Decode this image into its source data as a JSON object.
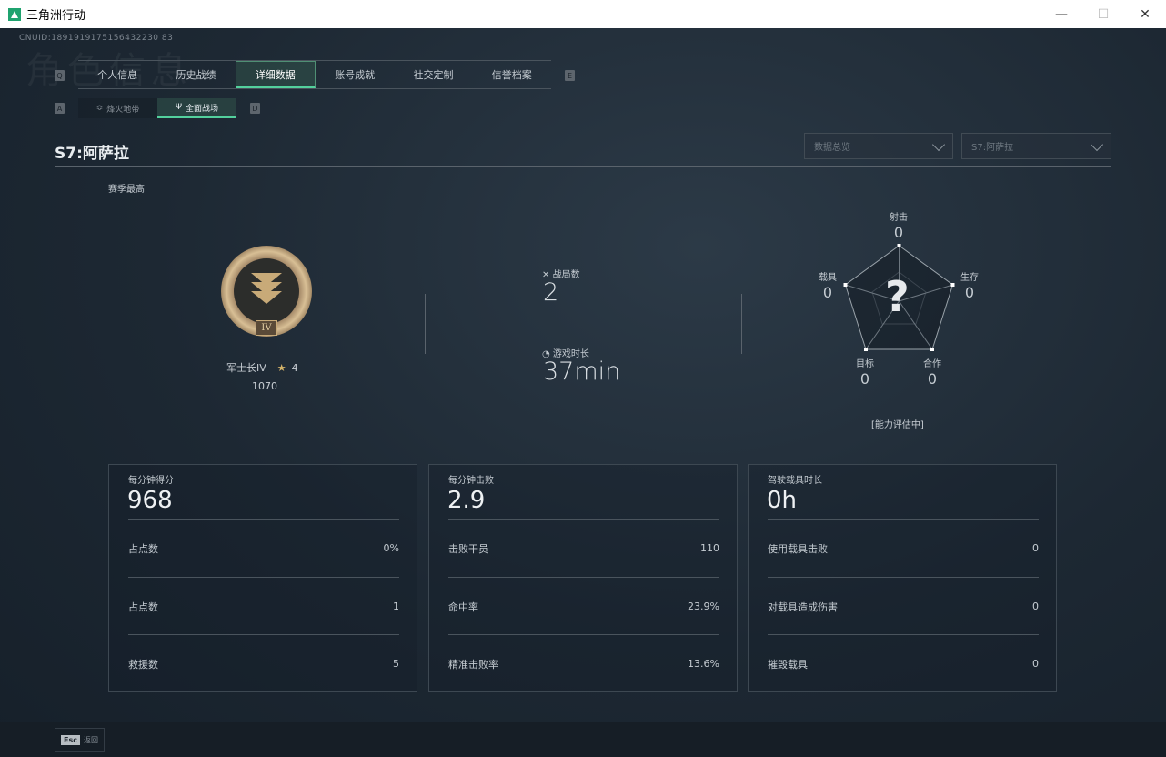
{
  "window": {
    "title": "三角洲行动",
    "minimize": "—",
    "maximize": "☐",
    "close": "✕"
  },
  "header": {
    "uid": "CNUID:1891919175156432230 83",
    "ghost_title": "角色信息"
  },
  "tabs": {
    "prev_key": "Q",
    "next_key": "E",
    "items": [
      {
        "label": "个人信息"
      },
      {
        "label": "历史战绩"
      },
      {
        "label": "详细数据",
        "active": true
      },
      {
        "label": "账号成就"
      },
      {
        "label": "社交定制"
      },
      {
        "label": "信誉档案"
      }
    ]
  },
  "subtabs": {
    "prev_key": "A",
    "next_key": "D",
    "items": [
      {
        "label": "烽火地带"
      },
      {
        "label": "全面战场",
        "active": true
      }
    ]
  },
  "season": {
    "title": "S7:阿萨拉",
    "dropdown1": "数据总览",
    "dropdown2": "S7:阿萨拉"
  },
  "rank": {
    "caption": "赛季最高",
    "name": "军士长IV",
    "stars": "4",
    "score": "1070",
    "numeral": "IV"
  },
  "summary": {
    "matches_label": "战局数",
    "matches": "2",
    "time_label": "游戏时长",
    "time": "37min"
  },
  "radar": {
    "placeholder": "?",
    "status": "[能力评估中]",
    "axes": [
      {
        "label": "射击",
        "value": "0"
      },
      {
        "label": "生存",
        "value": "0"
      },
      {
        "label": "合作",
        "value": "0"
      },
      {
        "label": "目标",
        "value": "0"
      },
      {
        "label": "载具",
        "value": "0"
      }
    ]
  },
  "cards": [
    {
      "title": "每分钟得分",
      "value": "968",
      "rows": [
        {
          "label": "占点数",
          "value": "0%"
        },
        {
          "label": "占点数",
          "value": "1"
        },
        {
          "label": "救援数",
          "value": "5"
        }
      ]
    },
    {
      "title": "每分钟击败",
      "value": "2.9",
      "rows": [
        {
          "label": "击败干员",
          "value": "110"
        },
        {
          "label": "命中率",
          "value": "23.9%"
        },
        {
          "label": "精准击败率",
          "value": "13.6%"
        }
      ]
    },
    {
      "title": "驾驶载具时长",
      "value": "0h",
      "rows": [
        {
          "label": "使用载具击败",
          "value": "0"
        },
        {
          "label": "对载具造成伤害",
          "value": "0"
        },
        {
          "label": "摧毁载具",
          "value": "0"
        }
      ]
    }
  ],
  "footer": {
    "esc_key": "Esc",
    "back_label": "返回"
  },
  "colors": {
    "accent": "#53d19d",
    "background": "#1b2530"
  }
}
